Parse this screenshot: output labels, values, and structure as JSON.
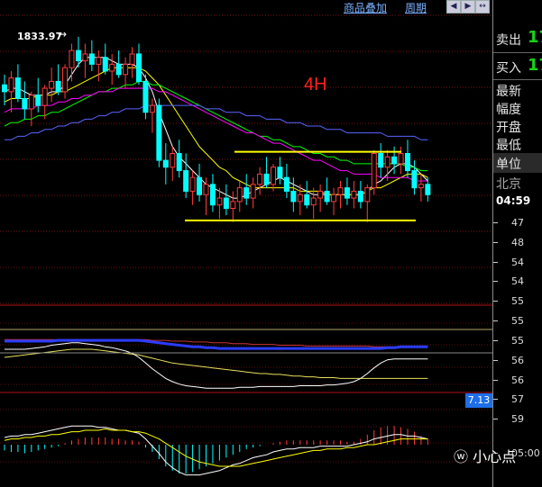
{
  "toolbar": {
    "overlay_link": "商品叠加",
    "period_link": "周期",
    "nav_buttons": [
      "◀",
      "▶",
      "↔"
    ]
  },
  "annotations": {
    "high_label": "1833.97",
    "timeframe_label": "4H"
  },
  "indicator": {
    "macd_value": "7.13"
  },
  "quote_panel": {
    "sell_label": "卖出",
    "sell_value": "17",
    "buy_label": "买入",
    "buy_value": "17",
    "latest_label": "最新",
    "change_label": "幅度",
    "open_label": "开盘",
    "low_label": "最低",
    "unit_label": "单位",
    "city_label": "北京",
    "time_label": "04:59"
  },
  "price_scale": [
    "47",
    "48",
    "54",
    "54",
    "55",
    "55",
    "55",
    "56",
    "56",
    "57",
    "59",
    "05:00"
  ],
  "watermark": "小心点",
  "colors": {
    "up": "#ff3c3c",
    "down": "#00ffff",
    "ma_white": "#ffffff",
    "ma_yellow": "#ffff00",
    "ma_green": "#00ff00",
    "ma_magenta": "#ff00ff",
    "ma_blue": "#5a64ff",
    "support_line": "#ffff00",
    "accent_blue": "#1e6ee8"
  },
  "chart_data": {
    "type": "candlestick",
    "candles": [
      {
        "o": 1820,
        "h": 1823,
        "l": 1814,
        "c": 1818
      },
      {
        "o": 1818,
        "h": 1824,
        "l": 1812,
        "c": 1822
      },
      {
        "o": 1822,
        "h": 1826,
        "l": 1815,
        "c": 1816
      },
      {
        "o": 1816,
        "h": 1821,
        "l": 1810,
        "c": 1813
      },
      {
        "o": 1813,
        "h": 1818,
        "l": 1808,
        "c": 1817
      },
      {
        "o": 1817,
        "h": 1822,
        "l": 1812,
        "c": 1814
      },
      {
        "o": 1814,
        "h": 1820,
        "l": 1810,
        "c": 1819
      },
      {
        "o": 1819,
        "h": 1825,
        "l": 1815,
        "c": 1821
      },
      {
        "o": 1821,
        "h": 1826,
        "l": 1817,
        "c": 1818
      },
      {
        "o": 1818,
        "h": 1826,
        "l": 1816,
        "c": 1825
      },
      {
        "o": 1825,
        "h": 1832,
        "l": 1821,
        "c": 1830
      },
      {
        "o": 1830,
        "h": 1834,
        "l": 1825,
        "c": 1827
      },
      {
        "o": 1827,
        "h": 1832,
        "l": 1822,
        "c": 1829
      },
      {
        "o": 1829,
        "h": 1833,
        "l": 1824,
        "c": 1826
      },
      {
        "o": 1826,
        "h": 1830,
        "l": 1821,
        "c": 1828
      },
      {
        "o": 1828,
        "h": 1832,
        "l": 1823,
        "c": 1824
      },
      {
        "o": 1824,
        "h": 1829,
        "l": 1820,
        "c": 1826
      },
      {
        "o": 1826,
        "h": 1830,
        "l": 1822,
        "c": 1823
      },
      {
        "o": 1823,
        "h": 1828,
        "l": 1819,
        "c": 1826
      },
      {
        "o": 1826,
        "h": 1831,
        "l": 1822,
        "c": 1829
      },
      {
        "o": 1829,
        "h": 1832,
        "l": 1820,
        "c": 1821
      },
      {
        "o": 1821,
        "h": 1823,
        "l": 1810,
        "c": 1812
      },
      {
        "o": 1812,
        "h": 1816,
        "l": 1806,
        "c": 1814
      },
      {
        "o": 1814,
        "h": 1816,
        "l": 1796,
        "c": 1798
      },
      {
        "o": 1798,
        "h": 1803,
        "l": 1791,
        "c": 1796
      },
      {
        "o": 1796,
        "h": 1802,
        "l": 1792,
        "c": 1800
      },
      {
        "o": 1800,
        "h": 1804,
        "l": 1793,
        "c": 1795
      },
      {
        "o": 1795,
        "h": 1800,
        "l": 1787,
        "c": 1789
      },
      {
        "o": 1789,
        "h": 1795,
        "l": 1785,
        "c": 1793
      },
      {
        "o": 1793,
        "h": 1797,
        "l": 1786,
        "c": 1788
      },
      {
        "o": 1788,
        "h": 1793,
        "l": 1782,
        "c": 1791
      },
      {
        "o": 1791,
        "h": 1794,
        "l": 1783,
        "c": 1785
      },
      {
        "o": 1785,
        "h": 1790,
        "l": 1781,
        "c": 1787
      },
      {
        "o": 1787,
        "h": 1791,
        "l": 1782,
        "c": 1784
      },
      {
        "o": 1784,
        "h": 1789,
        "l": 1780,
        "c": 1786
      },
      {
        "o": 1786,
        "h": 1792,
        "l": 1783,
        "c": 1790
      },
      {
        "o": 1790,
        "h": 1794,
        "l": 1785,
        "c": 1787
      },
      {
        "o": 1787,
        "h": 1793,
        "l": 1784,
        "c": 1791
      },
      {
        "o": 1791,
        "h": 1796,
        "l": 1788,
        "c": 1794
      },
      {
        "o": 1794,
        "h": 1799,
        "l": 1790,
        "c": 1791
      },
      {
        "o": 1791,
        "h": 1797,
        "l": 1789,
        "c": 1796
      },
      {
        "o": 1796,
        "h": 1799,
        "l": 1791,
        "c": 1793
      },
      {
        "o": 1793,
        "h": 1797,
        "l": 1787,
        "c": 1789
      },
      {
        "o": 1789,
        "h": 1793,
        "l": 1783,
        "c": 1786
      },
      {
        "o": 1786,
        "h": 1791,
        "l": 1782,
        "c": 1788
      },
      {
        "o": 1788,
        "h": 1792,
        "l": 1784,
        "c": 1785
      },
      {
        "o": 1785,
        "h": 1790,
        "l": 1781,
        "c": 1787
      },
      {
        "o": 1787,
        "h": 1791,
        "l": 1783,
        "c": 1789
      },
      {
        "o": 1789,
        "h": 1793,
        "l": 1785,
        "c": 1786
      },
      {
        "o": 1786,
        "h": 1790,
        "l": 1782,
        "c": 1788
      },
      {
        "o": 1788,
        "h": 1792,
        "l": 1784,
        "c": 1790
      },
      {
        "o": 1790,
        "h": 1793,
        "l": 1785,
        "c": 1787
      },
      {
        "o": 1787,
        "h": 1792,
        "l": 1784,
        "c": 1789
      },
      {
        "o": 1789,
        "h": 1792,
        "l": 1784,
        "c": 1786
      },
      {
        "o": 1786,
        "h": 1791,
        "l": 1780,
        "c": 1790
      },
      {
        "o": 1790,
        "h": 1801,
        "l": 1788,
        "c": 1800
      },
      {
        "o": 1800,
        "h": 1803,
        "l": 1793,
        "c": 1796
      },
      {
        "o": 1796,
        "h": 1801,
        "l": 1792,
        "c": 1799
      },
      {
        "o": 1799,
        "h": 1802,
        "l": 1794,
        "c": 1797
      },
      {
        "o": 1797,
        "h": 1802,
        "l": 1794,
        "c": 1800
      },
      {
        "o": 1800,
        "h": 1804,
        "l": 1793,
        "c": 1795
      },
      {
        "o": 1795,
        "h": 1798,
        "l": 1788,
        "c": 1790
      },
      {
        "o": 1790,
        "h": 1794,
        "l": 1786,
        "c": 1791
      },
      {
        "o": 1791,
        "h": 1793,
        "l": 1786,
        "c": 1788
      }
    ],
    "resistance_level": 1800.5,
    "support_level": 1780.5,
    "high_mark": 1833.97,
    "ma_lines": {
      "white": [
        1818,
        1819,
        1819,
        1818,
        1817,
        1817,
        1817,
        1818,
        1818,
        1820,
        1823,
        1826,
        1828,
        1828,
        1828,
        1828,
        1827,
        1826,
        1826,
        1826,
        1825,
        1822,
        1818,
        1812,
        1807,
        1802,
        1799,
        1797,
        1795,
        1793,
        1791,
        1790,
        1789,
        1788,
        1787,
        1787,
        1788,
        1789,
        1790,
        1791,
        1792,
        1793,
        1792,
        1791,
        1790,
        1789,
        1788,
        1788,
        1788,
        1788,
        1788,
        1788,
        1788,
        1788,
        1789,
        1791,
        1792,
        1794,
        1796,
        1797,
        1797,
        1796,
        1794,
        1792
      ],
      "yellow": [
        1815,
        1816,
        1816,
        1816,
        1816,
        1817,
        1817,
        1817,
        1818,
        1818,
        1819,
        1820,
        1821,
        1822,
        1823,
        1824,
        1825,
        1825,
        1825,
        1825,
        1825,
        1824,
        1822,
        1820,
        1817,
        1814,
        1811,
        1808,
        1805,
        1802,
        1800,
        1798,
        1796,
        1795,
        1793,
        1792,
        1791,
        1790,
        1790,
        1790,
        1790,
        1790,
        1790,
        1790,
        1789,
        1789,
        1789,
        1789,
        1788,
        1788,
        1788,
        1788,
        1788,
        1788,
        1789,
        1790,
        1790,
        1791,
        1792,
        1793,
        1794,
        1794,
        1794,
        1793
      ],
      "green": [
        1808,
        1809,
        1809,
        1810,
        1810,
        1811,
        1811,
        1812,
        1812,
        1813,
        1814,
        1815,
        1816,
        1817,
        1818,
        1818,
        1819,
        1819,
        1820,
        1820,
        1821,
        1821,
        1820,
        1820,
        1819,
        1818,
        1817,
        1816,
        1815,
        1814,
        1813,
        1812,
        1811,
        1810,
        1809,
        1808,
        1807,
        1806,
        1805,
        1805,
        1804,
        1804,
        1803,
        1802,
        1802,
        1801,
        1800,
        1800,
        1799,
        1799,
        1798,
        1798,
        1797,
        1797,
        1797,
        1797,
        1797,
        1797,
        1797,
        1797,
        1796,
        1796,
        1795,
        1795
      ],
      "magenta": [
        1812,
        1813,
        1813,
        1813,
        1813,
        1814,
        1814,
        1814,
        1815,
        1815,
        1816,
        1816,
        1817,
        1817,
        1818,
        1818,
        1818,
        1819,
        1819,
        1819,
        1819,
        1819,
        1819,
        1818,
        1818,
        1817,
        1816,
        1815,
        1814,
        1813,
        1812,
        1811,
        1810,
        1809,
        1808,
        1807,
        1806,
        1806,
        1805,
        1804,
        1803,
        1803,
        1802,
        1801,
        1800,
        1799,
        1798,
        1798,
        1797,
        1796,
        1795,
        1795,
        1794,
        1794,
        1794,
        1794,
        1793,
        1793,
        1793,
        1793,
        1793,
        1792,
        1792,
        1792
      ],
      "blue": [
        1804,
        1804,
        1805,
        1805,
        1806,
        1806,
        1807,
        1807,
        1808,
        1808,
        1809,
        1809,
        1810,
        1810,
        1811,
        1811,
        1812,
        1812,
        1813,
        1813,
        1813,
        1814,
        1814,
        1814,
        1814,
        1814,
        1814,
        1814,
        1814,
        1814,
        1813,
        1813,
        1813,
        1812,
        1812,
        1812,
        1811,
        1811,
        1811,
        1810,
        1810,
        1810,
        1809,
        1809,
        1809,
        1808,
        1808,
        1808,
        1807,
        1807,
        1807,
        1806,
        1806,
        1806,
        1806,
        1806,
        1806,
        1805,
        1805,
        1805,
        1805,
        1805,
        1804,
        1804
      ]
    },
    "oscillator": {
      "white": [
        0.5,
        0.5,
        0.5,
        0.5,
        0.51,
        0.52,
        0.53,
        0.55,
        0.56,
        0.57,
        0.58,
        0.58,
        0.57,
        0.56,
        0.55,
        0.53,
        0.52,
        0.5,
        0.48,
        0.45,
        0.4,
        0.33,
        0.26,
        0.2,
        0.14,
        0.1,
        0.07,
        0.05,
        0.04,
        0.03,
        0.02,
        0.02,
        0.02,
        0.02,
        0.02,
        0.03,
        0.03,
        0.03,
        0.04,
        0.04,
        0.04,
        0.04,
        0.04,
        0.04,
        0.05,
        0.05,
        0.05,
        0.05,
        0.06,
        0.06,
        0.07,
        0.08,
        0.1,
        0.14,
        0.2,
        0.27,
        0.33,
        0.37,
        0.38,
        0.38,
        0.38,
        0.38,
        0.38,
        0.38
      ],
      "yellow": [
        0.4,
        0.41,
        0.42,
        0.43,
        0.44,
        0.45,
        0.46,
        0.47,
        0.48,
        0.49,
        0.5,
        0.5,
        0.5,
        0.5,
        0.49,
        0.48,
        0.47,
        0.46,
        0.45,
        0.44,
        0.43,
        0.41,
        0.39,
        0.37,
        0.35,
        0.33,
        0.32,
        0.31,
        0.3,
        0.29,
        0.28,
        0.27,
        0.26,
        0.25,
        0.24,
        0.23,
        0.22,
        0.21,
        0.2,
        0.2,
        0.19,
        0.19,
        0.18,
        0.17,
        0.17,
        0.16,
        0.16,
        0.15,
        0.15,
        0.15,
        0.14,
        0.14,
        0.14,
        0.14,
        0.14,
        0.14,
        0.14,
        0.14,
        0.14,
        0.14,
        0.14,
        0.14,
        0.14,
        0.14
      ],
      "red": [
        0.62,
        0.62,
        0.62,
        0.62,
        0.62,
        0.62,
        0.62,
        0.62,
        0.62,
        0.62,
        0.62,
        0.62,
        0.62,
        0.62,
        0.62,
        0.62,
        0.62,
        0.62,
        0.62,
        0.62,
        0.62,
        0.62,
        0.61,
        0.61,
        0.61,
        0.6,
        0.6,
        0.6,
        0.59,
        0.59,
        0.59,
        0.58,
        0.58,
        0.58,
        0.57,
        0.57,
        0.57,
        0.56,
        0.56,
        0.56,
        0.56,
        0.55,
        0.55,
        0.55,
        0.55,
        0.54,
        0.54,
        0.54,
        0.54,
        0.54,
        0.54,
        0.54,
        0.54,
        0.54,
        0.54,
        0.53,
        0.53,
        0.53,
        0.53,
        0.53,
        0.53,
        0.53,
        0.53,
        0.53
      ],
      "blue": [
        0.6,
        0.6,
        0.6,
        0.6,
        0.6,
        0.6,
        0.6,
        0.6,
        0.61,
        0.61,
        0.61,
        0.61,
        0.61,
        0.61,
        0.61,
        0.61,
        0.61,
        0.61,
        0.61,
        0.61,
        0.61,
        0.6,
        0.59,
        0.58,
        0.57,
        0.56,
        0.55,
        0.54,
        0.53,
        0.53,
        0.52,
        0.52,
        0.51,
        0.51,
        0.51,
        0.51,
        0.51,
        0.51,
        0.51,
        0.51,
        0.51,
        0.51,
        0.51,
        0.51,
        0.51,
        0.51,
        0.51,
        0.51,
        0.51,
        0.51,
        0.51,
        0.51,
        0.51,
        0.51,
        0.51,
        0.51,
        0.51,
        0.52,
        0.52,
        0.53,
        0.53,
        0.53,
        0.53,
        0.53
      ]
    },
    "macd": {
      "hist": [
        -0.4,
        -0.5,
        -0.5,
        -0.6,
        -0.5,
        -0.4,
        -0.3,
        -0.2,
        -0.1,
        0.1,
        0.3,
        0.4,
        0.5,
        0.5,
        0.5,
        0.5,
        0.4,
        0.4,
        0.3,
        0.3,
        0.2,
        -0.2,
        -0.5,
        -1.0,
        -1.5,
        -1.8,
        -2.0,
        -2.0,
        -1.9,
        -1.7,
        -1.5,
        -1.3,
        -1.1,
        -0.9,
        -0.7,
        -0.5,
        -0.3,
        -0.2,
        -0.1,
        0.0,
        0.1,
        0.2,
        0.3,
        0.3,
        0.3,
        0.3,
        0.3,
        0.3,
        0.3,
        0.3,
        0.3,
        0.2,
        0.2,
        0.4,
        0.7,
        1.0,
        1.2,
        1.3,
        1.3,
        1.2,
        1.1,
        0.9,
        0.6,
        0.4
      ],
      "dif": [
        0.5,
        0.6,
        0.6,
        0.7,
        0.7,
        0.8,
        0.9,
        1.0,
        1.1,
        1.2,
        1.3,
        1.3,
        1.3,
        1.3,
        1.2,
        1.2,
        1.1,
        1.0,
        1.0,
        0.9,
        0.8,
        0.4,
        -0.1,
        -0.6,
        -1.2,
        -1.6,
        -1.9,
        -2.1,
        -2.1,
        -2.1,
        -2.0,
        -1.9,
        -1.8,
        -1.6,
        -1.4,
        -1.3,
        -1.1,
        -0.9,
        -0.8,
        -0.7,
        -0.5,
        -0.4,
        -0.3,
        -0.3,
        -0.2,
        -0.2,
        -0.2,
        -0.1,
        -0.1,
        -0.1,
        -0.1,
        -0.1,
        0.0,
        0.1,
        0.2,
        0.4,
        0.5,
        0.6,
        0.7,
        0.7,
        0.6,
        0.6,
        0.5,
        0.4
      ],
      "dea": [
        0.3,
        0.4,
        0.4,
        0.5,
        0.5,
        0.6,
        0.6,
        0.7,
        0.7,
        0.8,
        0.9,
        0.9,
        1.0,
        1.0,
        1.0,
        1.1,
        1.0,
        1.0,
        1.0,
        0.9,
        0.9,
        0.8,
        0.6,
        0.4,
        0.1,
        -0.2,
        -0.5,
        -0.8,
        -1.0,
        -1.2,
        -1.3,
        -1.4,
        -1.5,
        -1.5,
        -1.5,
        -1.5,
        -1.4,
        -1.3,
        -1.2,
        -1.1,
        -1.0,
        -0.9,
        -0.8,
        -0.7,
        -0.6,
        -0.5,
        -0.4,
        -0.4,
        -0.3,
        -0.3,
        -0.3,
        -0.2,
        -0.2,
        -0.1,
        0.0,
        0.0,
        0.1,
        0.2,
        0.3,
        0.4,
        0.4,
        0.4,
        0.4,
        0.4
      ]
    }
  }
}
